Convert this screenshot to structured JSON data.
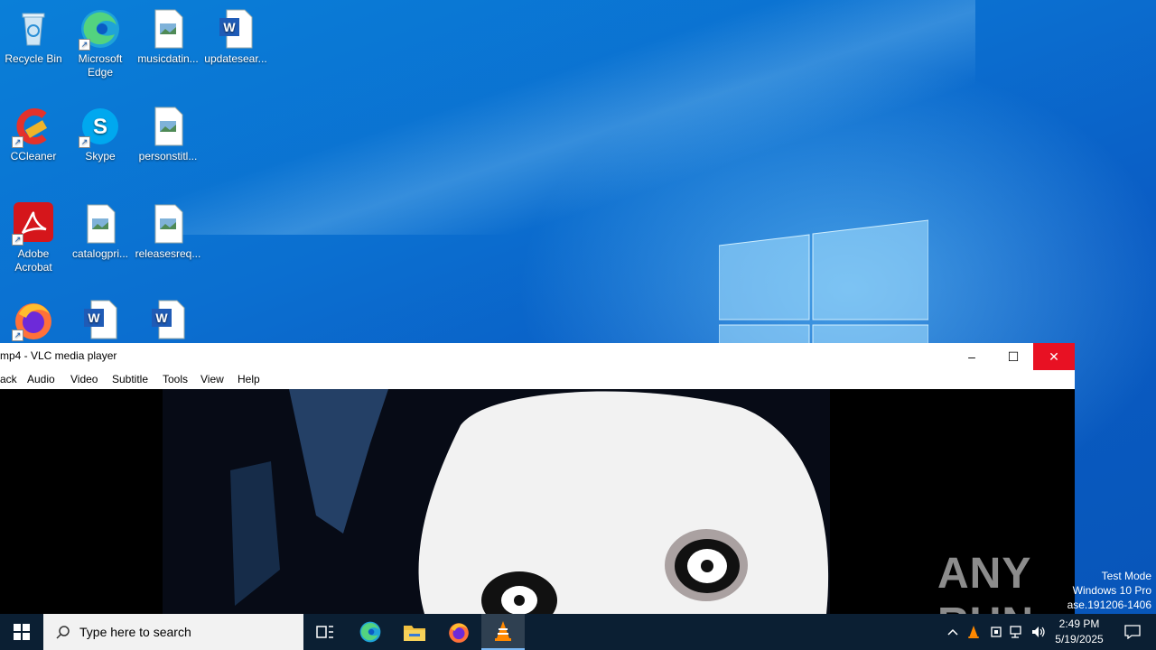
{
  "desktop": {
    "icons": [
      {
        "label": "Recycle Bin",
        "icon": "recycle-bin-icon"
      },
      {
        "label": "Microsoft Edge",
        "icon": "edge-icon"
      },
      {
        "label": "musicdatin...",
        "icon": "image-file-icon"
      },
      {
        "label": "updatesear...",
        "icon": "word-doc-icon"
      },
      {
        "label": "CCleaner",
        "icon": "ccleaner-icon"
      },
      {
        "label": "Skype",
        "icon": "skype-icon"
      },
      {
        "label": "personstitl...",
        "icon": "image-file-icon"
      },
      {
        "label": "Adobe Acrobat",
        "icon": "acrobat-icon"
      },
      {
        "label": "catalogpri...",
        "icon": "image-file-icon"
      },
      {
        "label": "releasesreq...",
        "icon": "image-file-icon"
      },
      {
        "label": "",
        "icon": "firefox-icon"
      },
      {
        "label": "",
        "icon": "word-doc-icon"
      },
      {
        "label": "",
        "icon": "word-doc-icon"
      }
    ]
  },
  "vlc": {
    "title": "mp4 - VLC media player",
    "menu": [
      "ack",
      "Audio",
      "Video",
      "Subtitle",
      "Tools",
      "View",
      "Help"
    ],
    "controls": {
      "minimize": "–",
      "maximize": "☐",
      "close": "✕"
    }
  },
  "watermark": "ANY RUN",
  "system_notice": {
    "line1": "Test Mode",
    "line2": "Windows 10 Pro",
    "line3": "ase.191206-1406"
  },
  "taskbar": {
    "search_placeholder": "Type here to search",
    "apps": [
      "task-view-icon",
      "edge-icon",
      "file-explorer-icon",
      "firefox-icon",
      "vlc-icon"
    ],
    "time": "2:49 PM",
    "date": "5/19/2025"
  },
  "colors": {
    "taskbar": "#0b1f33",
    "close_red": "#e81123",
    "desktop_blue": "#0a6fd0"
  }
}
